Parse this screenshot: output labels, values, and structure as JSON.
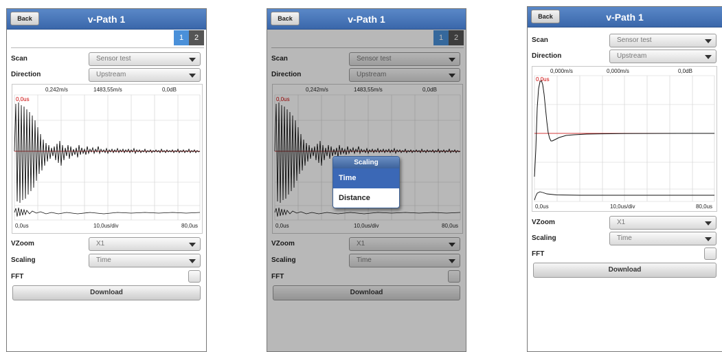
{
  "screens": [
    {
      "back_label": "Back",
      "title": "v-Path 1",
      "tabs": [
        "1",
        "2"
      ],
      "scan": {
        "label": "Scan",
        "value": "Sensor test"
      },
      "direction": {
        "label": "Direction",
        "value": "Upstream"
      },
      "chart": {
        "speed": "0,242m/s",
        "sound_speed": "1483,55m/s",
        "gain": "0,0dB",
        "marker": "0,0us",
        "x_start": "0,0us",
        "x_div": "10,0us/div",
        "x_end": "80,0us"
      },
      "vzoom": {
        "label": "VZoom",
        "value": "X1"
      },
      "scaling": {
        "label": "Scaling",
        "value": "Time"
      },
      "fft": {
        "label": "FFT"
      },
      "download_label": "Download"
    },
    {
      "back_label": "Back",
      "title": "v-Path 1",
      "tabs": [
        "1",
        "2"
      ],
      "scan": {
        "label": "Scan",
        "value": "Sensor test"
      },
      "direction": {
        "label": "Direction",
        "value": "Upstream"
      },
      "chart": {
        "speed": "0,242m/s",
        "sound_speed": "1483,55m/s",
        "gain": "0,0dB",
        "marker": "0,0us",
        "x_start": "0,0us",
        "x_div": "10,0us/div",
        "x_end": "80,0us"
      },
      "vzoom": {
        "label": "VZoom",
        "value": "X1"
      },
      "scaling": {
        "label": "Scaling",
        "value": "Time"
      },
      "fft": {
        "label": "FFT"
      },
      "download_label": "Download",
      "popup": {
        "title": "Scaling",
        "options": [
          "Time",
          "Distance"
        ],
        "selected": "Time"
      }
    },
    {
      "back_label": "Back",
      "title": "v-Path 1",
      "scan": {
        "label": "Scan",
        "value": "Sensor test"
      },
      "direction": {
        "label": "Direction",
        "value": "Upstream"
      },
      "chart": {
        "speed": "0,000m/s",
        "sound_speed": "0,000m/s",
        "gain": "0,0dB",
        "marker": "0,0us",
        "x_start": "0,0us",
        "x_div": "10,0us/div",
        "x_end": "80,0us"
      },
      "vzoom": {
        "label": "VZoom",
        "value": "X1"
      },
      "scaling": {
        "label": "Scaling",
        "value": "Time"
      },
      "fft": {
        "label": "FFT"
      },
      "download_label": "Download"
    }
  ],
  "colors": {
    "header": "#3a67aa",
    "tab_active": "#4a90d9",
    "tab_inactive": "#555555",
    "marker_line": "#c00000",
    "selected_item": "#3b68b6"
  }
}
